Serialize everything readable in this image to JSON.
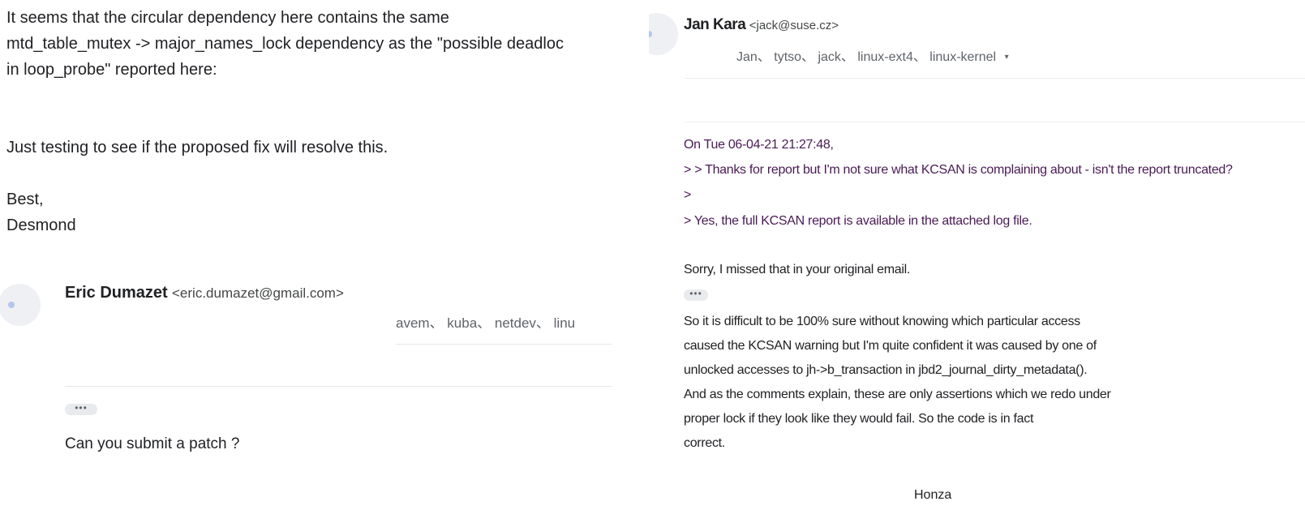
{
  "left": {
    "body_lines": [
      "It seems that the circular dependency here contains the same",
      "mtd_table_mutex -> major_names_lock dependency as the \"possible deadloc",
      "in loop_probe\" reported here:",
      "Just testing to see if the proposed fix will resolve this.",
      "Best,",
      "Desmond"
    ],
    "reply": {
      "sender_name": "Eric Dumazet",
      "sender_email": "<eric.dumazet@gmail.com>",
      "recipients": "avem、 kuba、 netdev、 linu",
      "ellipsis": "•••",
      "body": "Can you submit a patch ?"
    }
  },
  "right": {
    "sender_name": "Jan Kara",
    "sender_email": "<jack@suse.cz>",
    "recipients": "Jan、 tytso、 jack、 linux-ext4、 linux-kernel",
    "recipients_caret": "▾",
    "quoted_lines": [
      "On Tue 06-04-21 21:27:48,",
      "> > Thanks for report but I'm not sure what KCSAN is complaining about - isn't the report truncated?",
      ">",
      "> Yes, the full KCSAN report is available in the attached log file."
    ],
    "sorry_line": "Sorry, I missed that in your original email.",
    "ellipsis": "•••",
    "body_lines": [
      "So it is difficult to be 100% sure without knowing which particular access",
      "caused the KCSAN warning but I'm quite confident it was caused by one of",
      "unlocked accesses to jh->b_transaction in jbd2_journal_dirty_metadata().",
      "And as the comments explain, these are only assertions which we redo under",
      "proper lock if they look like they would fail. So the code is in fact",
      "correct."
    ],
    "signature": "Honza"
  }
}
